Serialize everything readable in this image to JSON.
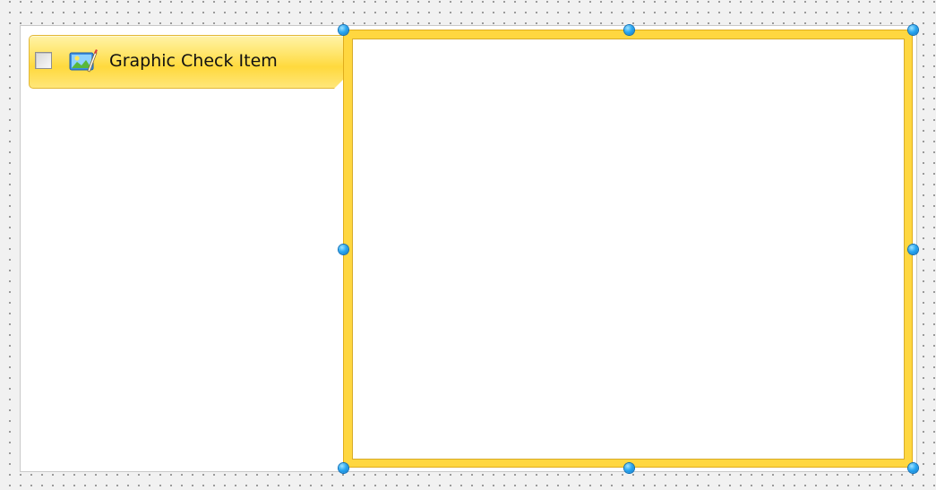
{
  "tab_item": {
    "label": "Graphic Check Item",
    "checked": false,
    "icon": "picture-edit-icon"
  },
  "colors": {
    "selection_accent": "#ffd740",
    "selection_handle": "#2aa8f2",
    "designer_background": "#f1f1f1"
  }
}
